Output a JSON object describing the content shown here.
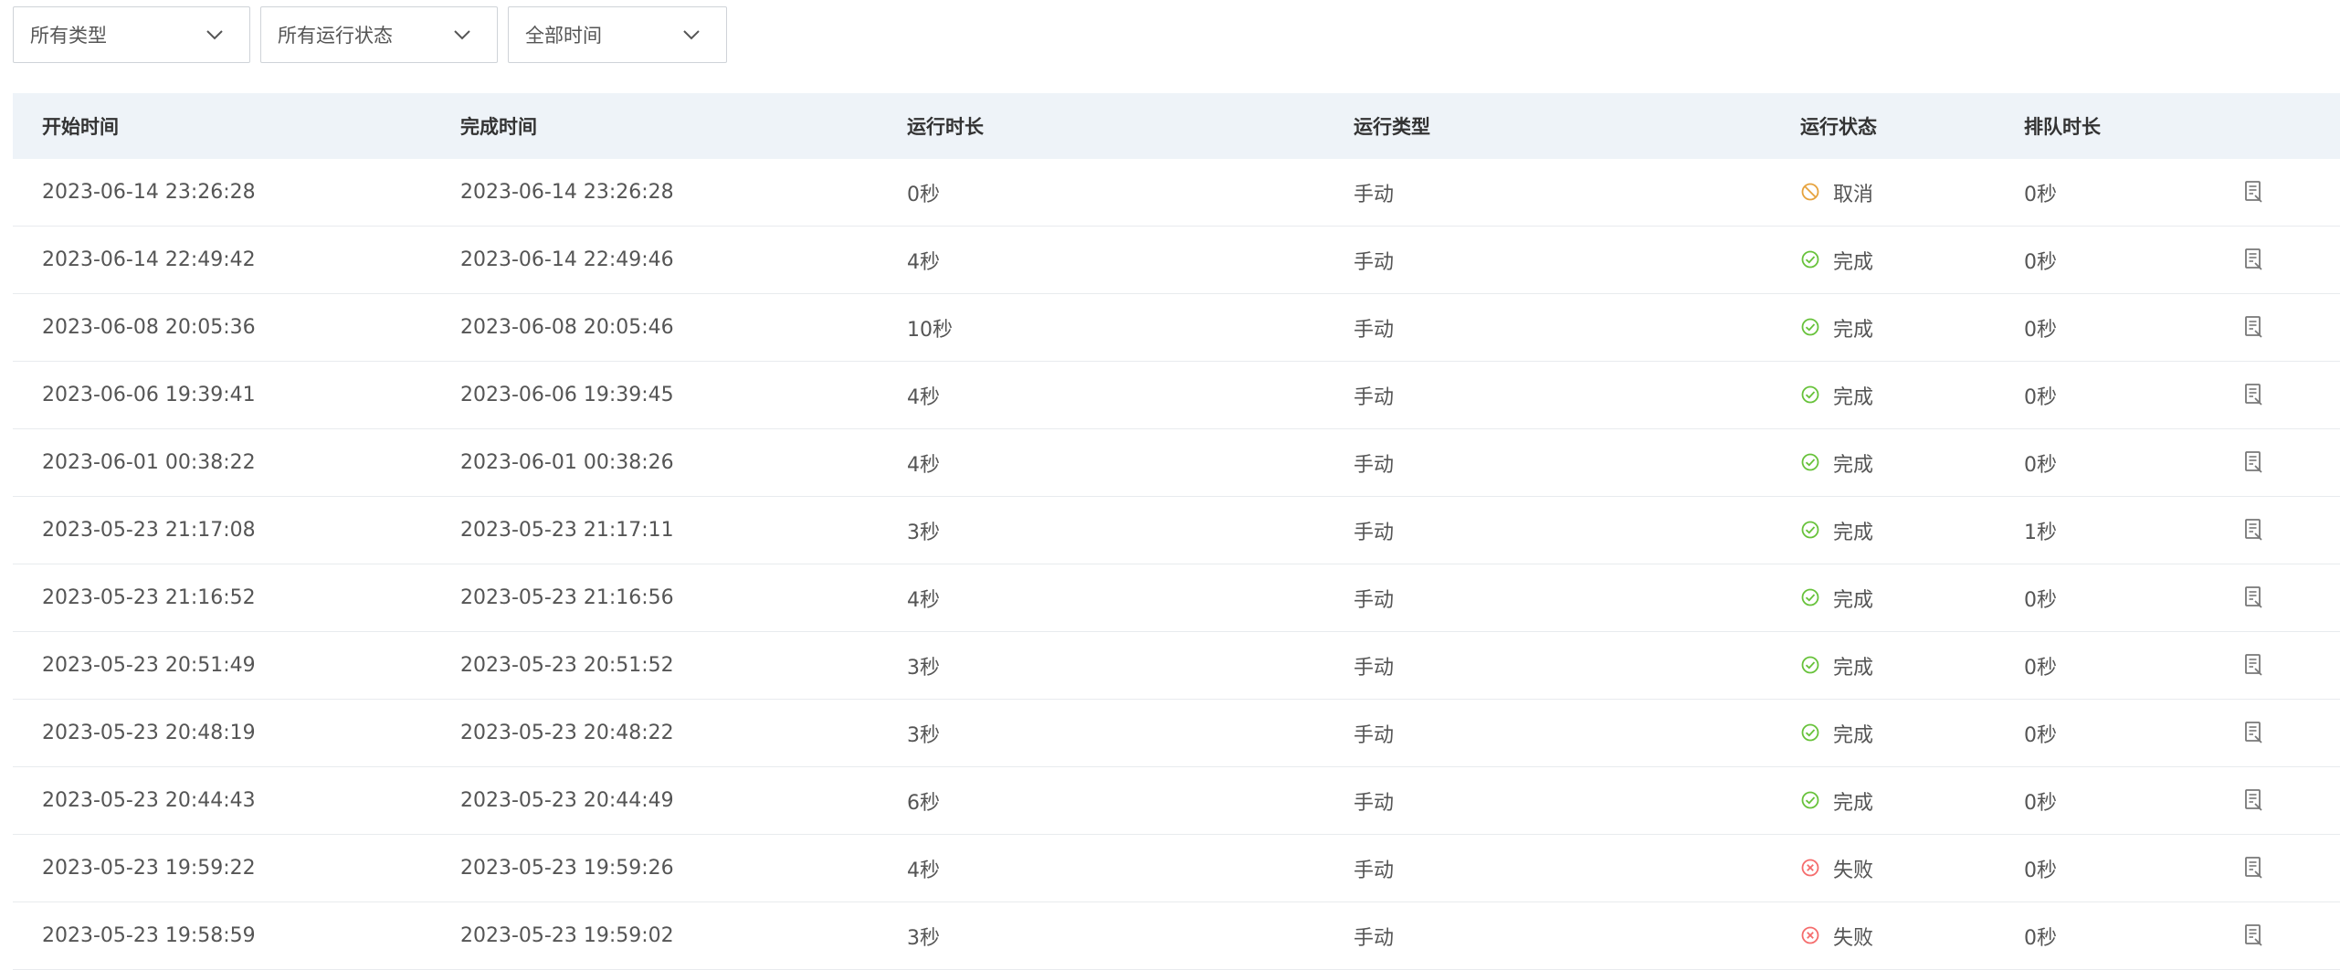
{
  "filters": {
    "type": "所有类型",
    "status": "所有运行状态",
    "time": "全部时间"
  },
  "columns": [
    "开始时间",
    "完成时间",
    "运行时长",
    "运行类型",
    "运行状态",
    "排队时长"
  ],
  "colors": {
    "cancel": "#e6a23c",
    "success": "#67c23a",
    "fail": "#f56c6c",
    "header_bg": "#eef3f8"
  },
  "rows": [
    {
      "start": "2023-06-14 23:26:28",
      "end": "2023-06-14 23:26:28",
      "duration": "0秒",
      "type": "手动",
      "status": "取消",
      "status_key": "cancel",
      "queue": "0秒"
    },
    {
      "start": "2023-06-14 22:49:42",
      "end": "2023-06-14 22:49:46",
      "duration": "4秒",
      "type": "手动",
      "status": "完成",
      "status_key": "success",
      "queue": "0秒"
    },
    {
      "start": "2023-06-08 20:05:36",
      "end": "2023-06-08 20:05:46",
      "duration": "10秒",
      "type": "手动",
      "status": "完成",
      "status_key": "success",
      "queue": "0秒"
    },
    {
      "start": "2023-06-06 19:39:41",
      "end": "2023-06-06 19:39:45",
      "duration": "4秒",
      "type": "手动",
      "status": "完成",
      "status_key": "success",
      "queue": "0秒"
    },
    {
      "start": "2023-06-01 00:38:22",
      "end": "2023-06-01 00:38:26",
      "duration": "4秒",
      "type": "手动",
      "status": "完成",
      "status_key": "success",
      "queue": "0秒"
    },
    {
      "start": "2023-05-23 21:17:08",
      "end": "2023-05-23 21:17:11",
      "duration": "3秒",
      "type": "手动",
      "status": "完成",
      "status_key": "success",
      "queue": "1秒"
    },
    {
      "start": "2023-05-23 21:16:52",
      "end": "2023-05-23 21:16:56",
      "duration": "4秒",
      "type": "手动",
      "status": "完成",
      "status_key": "success",
      "queue": "0秒"
    },
    {
      "start": "2023-05-23 20:51:49",
      "end": "2023-05-23 20:51:52",
      "duration": "3秒",
      "type": "手动",
      "status": "完成",
      "status_key": "success",
      "queue": "0秒"
    },
    {
      "start": "2023-05-23 20:48:19",
      "end": "2023-05-23 20:48:22",
      "duration": "3秒",
      "type": "手动",
      "status": "完成",
      "status_key": "success",
      "queue": "0秒"
    },
    {
      "start": "2023-05-23 20:44:43",
      "end": "2023-05-23 20:44:49",
      "duration": "6秒",
      "type": "手动",
      "status": "完成",
      "status_key": "success",
      "queue": "0秒"
    },
    {
      "start": "2023-05-23 19:59:22",
      "end": "2023-05-23 19:59:26",
      "duration": "4秒",
      "type": "手动",
      "status": "失败",
      "status_key": "fail",
      "queue": "0秒"
    },
    {
      "start": "2023-05-23 19:58:59",
      "end": "2023-05-23 19:59:02",
      "duration": "3秒",
      "type": "手动",
      "status": "失败",
      "status_key": "fail",
      "queue": "0秒"
    }
  ]
}
